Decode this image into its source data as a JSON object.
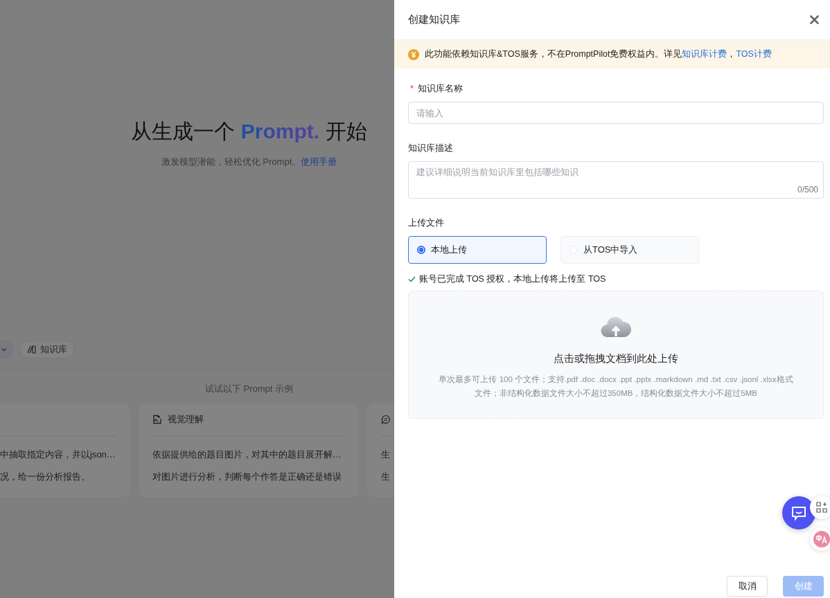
{
  "background_page": {
    "hero": {
      "title_prefix": "从生成一个 ",
      "title_highlight": "Prompt.",
      "title_suffix": " 开始",
      "subtitle": "激发模型潜能，轻松优化 Prompt。",
      "manual_link": "使用手册"
    },
    "toolbar": [
      {
        "kind": "dropdown"
      },
      {
        "kind": "chip",
        "label": "知识库"
      }
    ],
    "examples_heading": "试试以下 Prompt 示例",
    "example_cards": [
      {
        "kind": "plain",
        "lines": [
          "中抽取指定内容，并以json…",
          "况，给一份分析报告。"
        ]
      },
      {
        "kind": "image",
        "title": "视觉理解",
        "lines": [
          "依据提供给的题目图片，对其中的题目展开解…",
          "对图片进行分析，判断每个作答是正确还是错误"
        ]
      },
      {
        "kind": "chat",
        "lines": [
          "生",
          "生"
        ]
      }
    ]
  },
  "drawer": {
    "title": "创建知识库",
    "notice": {
      "text": "此功能依赖知识库&TOS服务，不在PromptPilot免费权益内。详见",
      "links": [
        "知识库计费",
        "TOS计费"
      ],
      "separator": "，"
    },
    "name_field": {
      "label": "知识库名称",
      "required_mark": "*",
      "placeholder": "请输入"
    },
    "description_field": {
      "label": "知识库描述",
      "placeholder": "建议详细说明当前知识库里包括哪些知识",
      "counter": "0/500"
    },
    "upload": {
      "label": "上传文件",
      "options": [
        {
          "label": "本地上传",
          "selected": true
        },
        {
          "label": "从TOS中导入",
          "selected": false
        }
      ],
      "auth_note": "账号已完成 TOS 授权，本地上传将上传至 TOS",
      "dropzone_title": "点击或拖拽文档到此处上传",
      "dropzone_hint": "单次最多可上传 100 个文件；支持.pdf .doc .docx .ppt .pptx .markdown .md .txt .csv .jsonl .xlsx格式文件；非结构化数据文件大小不超过350MB，结构化数据文件大小不超过5MB"
    },
    "buttons": [
      {
        "label": "取消",
        "kind": "secondary"
      },
      {
        "label": "创建",
        "kind": "primary",
        "disabled": true
      }
    ]
  }
}
